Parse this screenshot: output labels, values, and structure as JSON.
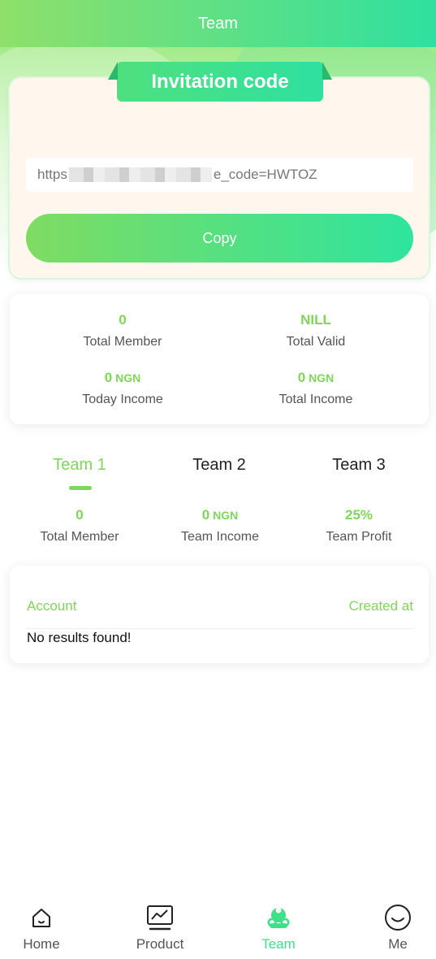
{
  "header": {
    "title": "Team"
  },
  "invite": {
    "ribbon_title": "Invitation code",
    "link_prefix": "https",
    "link_suffix": "e_code=HWTOZ",
    "copy_label": "Copy"
  },
  "stats": {
    "total_member": {
      "value": "0",
      "label": "Total Member"
    },
    "total_valid": {
      "value": "NILL",
      "label": "Total Valid"
    },
    "today_income": {
      "value": "0",
      "unit": "NGN",
      "label": "Today Income"
    },
    "total_income": {
      "value": "0",
      "unit": "NGN",
      "label": "Total Income"
    }
  },
  "tabs": [
    {
      "label": "Team 1",
      "active": true
    },
    {
      "label": "Team 2",
      "active": false
    },
    {
      "label": "Team 3",
      "active": false
    }
  ],
  "team_stats": {
    "total_member": {
      "value": "0",
      "label": "Total Member"
    },
    "team_income": {
      "value": "0",
      "unit": "NGN",
      "label": "Team Income"
    },
    "team_profit": {
      "value": "25%",
      "label": "Team Profit"
    }
  },
  "table": {
    "col_account": "Account",
    "col_created": "Created at",
    "empty_text": "No results found!"
  },
  "nav": [
    {
      "label": "Home",
      "icon": "home-icon"
    },
    {
      "label": "Product",
      "icon": "chart-icon"
    },
    {
      "label": "Team",
      "icon": "team-icon",
      "active": true
    },
    {
      "label": "Me",
      "icon": "smile-icon"
    }
  ],
  "colors": {
    "accent": "#7fd65a",
    "accent2": "#2fe0a0",
    "nav_active": "#3fe08a"
  }
}
